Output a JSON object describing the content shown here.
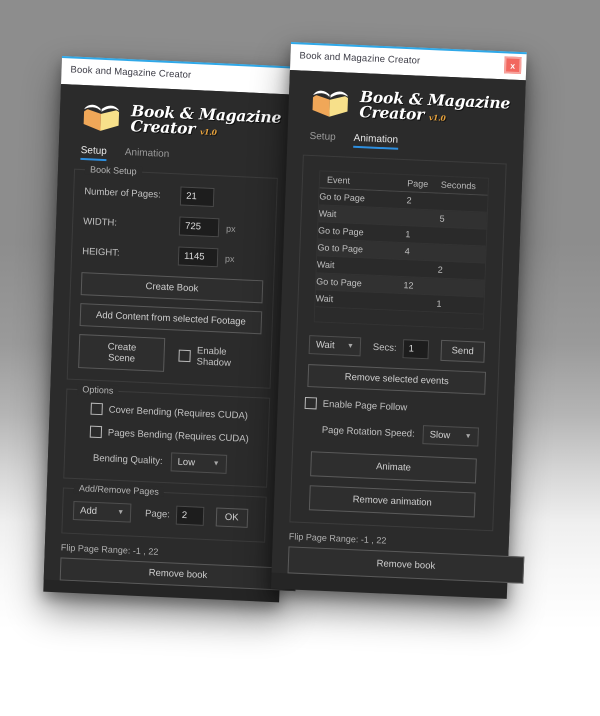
{
  "app": {
    "window_title": "Book and Magazine Creator",
    "close_label": "x",
    "logo": {
      "line1": "Book & Magazine",
      "line2": "Creator",
      "version": "v1.0",
      "icon": "open-book-icon"
    },
    "accent_color": "#2d8fe0",
    "titlebar_color": "#ffffff",
    "close_color": "#f2675f",
    "version_color": "#e8a33d"
  },
  "tabs": [
    {
      "label": "Setup"
    },
    {
      "label": "Animation"
    }
  ],
  "left_window": {
    "active_tab": "Setup",
    "book_setup": {
      "legend": "Book Setup",
      "pages_label": "Number of Pages:",
      "pages_value": "21",
      "width_label": "WIDTH:",
      "width_value": "725",
      "width_unit": "px",
      "height_label": "HEIGHT:",
      "height_value": "1145",
      "height_unit": "px",
      "create_book": "Create Book",
      "add_content": "Add Content from selected Footage",
      "create_scene": "Create Scene",
      "enable_shadow": "Enable Shadow",
      "enable_shadow_checked": false
    },
    "options": {
      "legend": "Options",
      "cover_bending": "Cover Bending (Requires CUDA)",
      "cover_bending_checked": false,
      "pages_bending": "Pages Bending (Requires CUDA)",
      "pages_bending_checked": false,
      "bending_quality_label": "Bending Quality:",
      "bending_quality_value": "Low"
    },
    "add_remove": {
      "legend": "Add/Remove Pages",
      "action_value": "Add",
      "page_label": "Page:",
      "page_value": "2",
      "ok_label": "OK"
    },
    "flip_range": "Flip Page Range: -1 , 22",
    "remove_book": "Remove book"
  },
  "right_window": {
    "active_tab": "Animation",
    "events_table": {
      "columns": [
        "Event",
        "Page",
        "Seconds"
      ],
      "rows": [
        {
          "event": "Go to Page",
          "page": "2",
          "seconds": ""
        },
        {
          "event": "Wait",
          "page": "",
          "seconds": "5"
        },
        {
          "event": "Go to Page",
          "page": "1",
          "seconds": ""
        },
        {
          "event": "Go to Page",
          "page": "4",
          "seconds": ""
        },
        {
          "event": "Wait",
          "page": "",
          "seconds": "2"
        },
        {
          "event": "Go to Page",
          "page": "12",
          "seconds": ""
        },
        {
          "event": "Wait",
          "page": "",
          "seconds": "1"
        }
      ]
    },
    "event_controls": {
      "event_type_value": "Wait",
      "secs_label": "Secs:",
      "secs_value": "1",
      "send_label": "Send",
      "remove_selected": "Remove selected events"
    },
    "page_follow": {
      "label": "Enable Page Follow",
      "checked": false
    },
    "rotation": {
      "label": "Page Rotation Speed:",
      "value": "Slow"
    },
    "animate_label": "Animate",
    "remove_animation_label": "Remove animation",
    "flip_range": "Flip Page Range: -1 , 22",
    "remove_book": "Remove book"
  }
}
